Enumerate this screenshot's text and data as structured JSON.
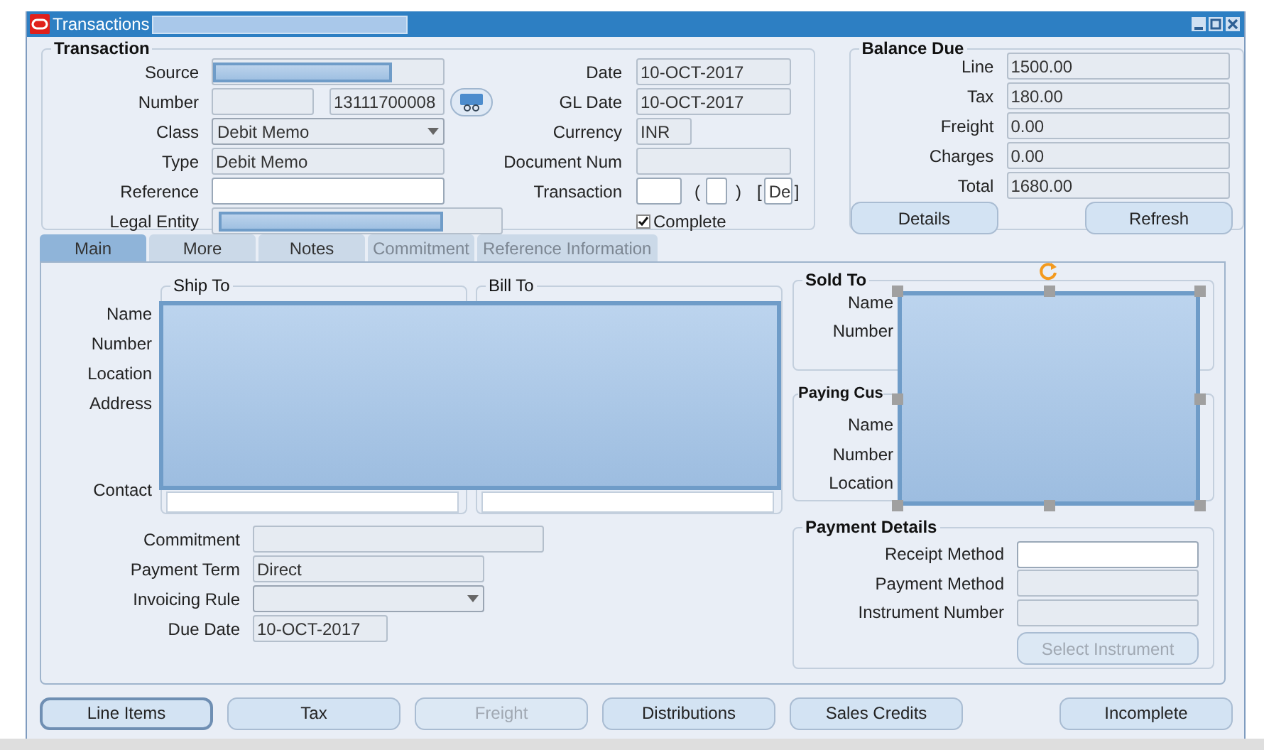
{
  "window": {
    "title": "Transactions"
  },
  "transaction": {
    "title": "Transaction",
    "left": [
      {
        "label": "Source",
        "kind": "redacted",
        "editable": false
      },
      {
        "label": "Number",
        "kind": "pair",
        "value": "13111700008",
        "editable": false
      },
      {
        "label": "Class",
        "kind": "select",
        "value": "Debit Memo",
        "editable": false
      },
      {
        "label": "Type",
        "kind": "text",
        "value": "Debit Memo",
        "editable": false
      },
      {
        "label": "Reference",
        "kind": "text",
        "editable": true
      },
      {
        "label": "Legal Entity",
        "kind": "redacted_wide",
        "editable": false
      }
    ],
    "right": [
      {
        "label": "Date",
        "kind": "text",
        "value": "10-OCT-2017",
        "editable": false
      },
      {
        "label": "GL Date",
        "kind": "text",
        "value": "10-OCT-2017",
        "editable": false
      },
      {
        "label": "Currency",
        "kind": "short",
        "value": "INR",
        "editable": false
      },
      {
        "label": "Document Num",
        "kind": "text",
        "editable": false
      },
      {
        "label": "Transaction",
        "kind": "parens",
        "open": "(",
        "close": ")",
        "left_bracket": "[",
        "right_bracket": "]",
        "value": "De",
        "editable": true
      }
    ],
    "complete": {
      "label": "Complete",
      "checked": true
    }
  },
  "balance_due": {
    "title": "Balance Due",
    "fields": [
      {
        "label": "Line",
        "value": "1500.00"
      },
      {
        "label": "Tax",
        "value": "180.00"
      },
      {
        "label": "Freight",
        "value": "0.00"
      },
      {
        "label": "Charges",
        "value": "0.00"
      },
      {
        "label": "Total",
        "value": "1680.00"
      }
    ],
    "buttons": [
      "Details",
      "Refresh"
    ]
  },
  "tabs": [
    {
      "label": "Main",
      "selected": true,
      "disabled": false
    },
    {
      "label": "More",
      "selected": false,
      "disabled": false
    },
    {
      "label": "Notes",
      "selected": false,
      "disabled": false
    },
    {
      "label": "Commitment",
      "selected": false,
      "disabled": true
    },
    {
      "label": "Reference Information",
      "selected": false,
      "disabled": true
    }
  ],
  "main": {
    "address_labels": [
      "Name",
      "Number",
      "Location",
      "Address",
      "Contact"
    ],
    "ship_to": {
      "title": "Ship To"
    },
    "bill_to": {
      "title": "Bill To"
    },
    "fields": [
      {
        "label": "Commitment",
        "kind": "text"
      },
      {
        "label": "Payment Term",
        "kind": "text",
        "value": "Direct"
      },
      {
        "label": "Invoicing Rule",
        "kind": "select"
      },
      {
        "label": "Due Date",
        "kind": "text",
        "value": "10-OCT-2017"
      }
    ],
    "sold_to": {
      "title": "Sold To",
      "labels": [
        "Name",
        "Number"
      ]
    },
    "paying_customer": {
      "title": "Paying Cus",
      "labels": [
        "Name",
        "Number",
        "Location"
      ]
    },
    "payment_details": {
      "title": "Payment Details",
      "fields": [
        {
          "label": "Receipt Method",
          "editable": true
        },
        {
          "label": "Payment Method",
          "editable": false
        },
        {
          "label": "Instrument Number",
          "editable": false
        }
      ],
      "button": {
        "label": "Select Instrument",
        "disabled": true
      }
    }
  },
  "buttons": [
    {
      "label": "Line Items",
      "focused": true,
      "disabled": false
    },
    {
      "label": "Tax",
      "focused": false,
      "disabled": false
    },
    {
      "label": "Freight",
      "focused": false,
      "disabled": true
    },
    {
      "label": "Distributions",
      "focused": false,
      "disabled": false
    },
    {
      "label": "Sales Credits",
      "focused": false,
      "disabled": false
    },
    {
      "label": "Incomplete",
      "focused": false,
      "disabled": false
    }
  ]
}
